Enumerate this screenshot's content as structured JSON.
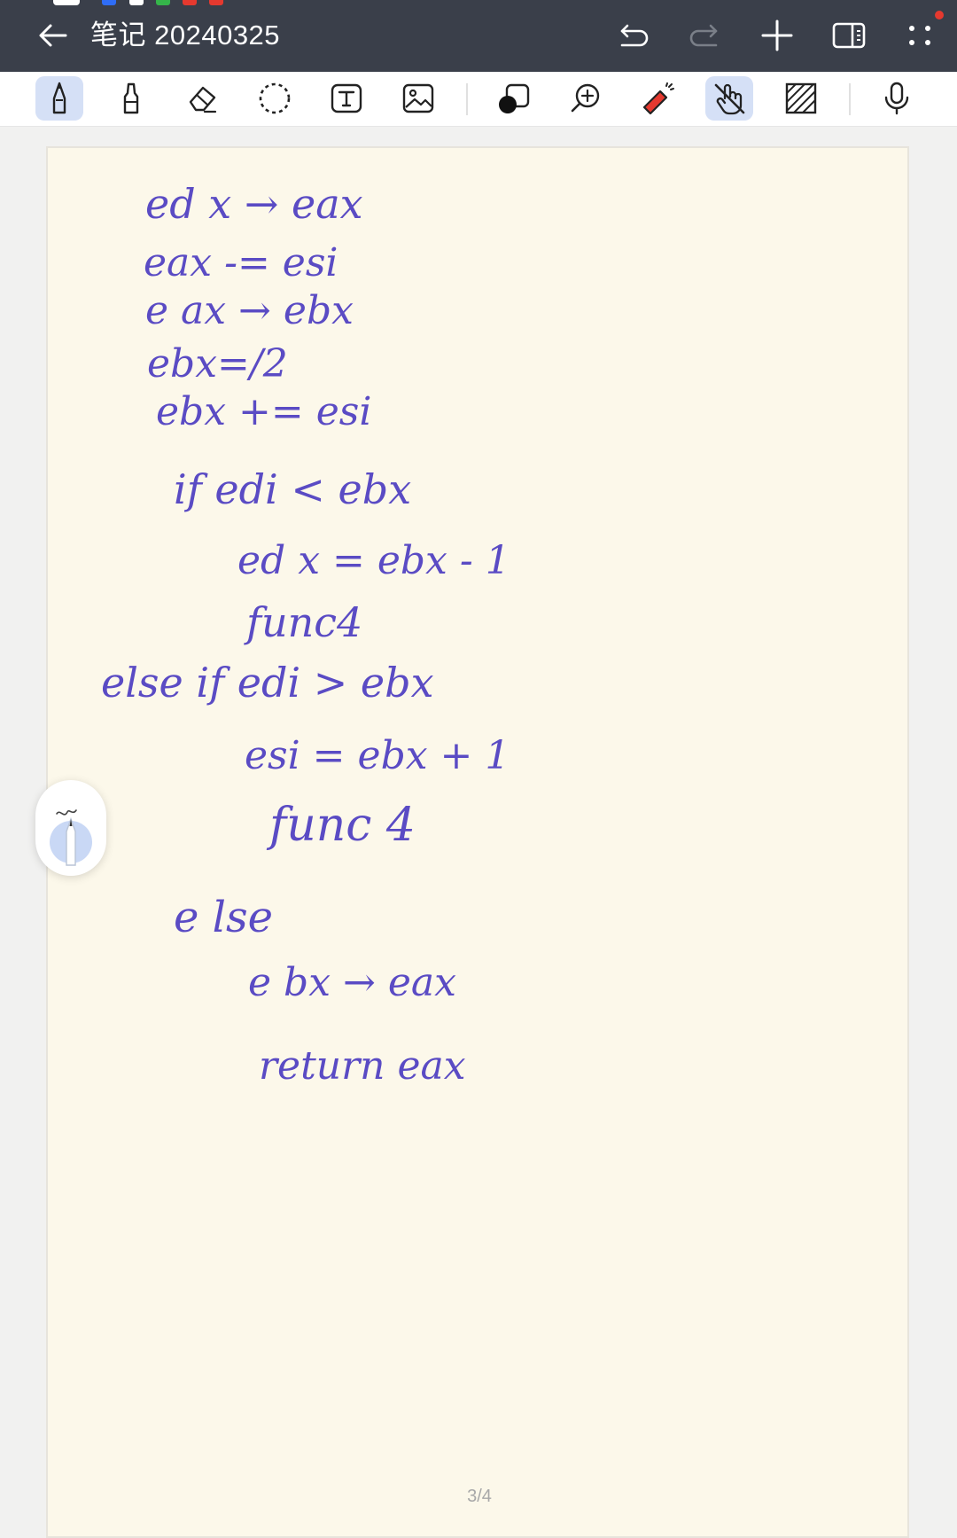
{
  "app": {
    "title": "笔记 20240325"
  },
  "topbar": {
    "back_icon": "arrow-left-icon",
    "actions": [
      {
        "name": "undo",
        "icon": "undo-icon",
        "enabled": true
      },
      {
        "name": "redo",
        "icon": "redo-icon",
        "enabled": false
      },
      {
        "name": "add-page",
        "icon": "plus-icon",
        "enabled": true
      },
      {
        "name": "split-view",
        "icon": "split-panel-icon",
        "enabled": true
      },
      {
        "name": "more",
        "icon": "more-dots-icon",
        "enabled": true
      }
    ],
    "notification_color": "#e5392f",
    "status_dot_colors": [
      "#ffffff",
      "#2f6df6",
      "#ffffff",
      "#35b54a",
      "#e5392f",
      "#e5392f"
    ]
  },
  "toolbar": {
    "tools": [
      {
        "name": "pen",
        "icon": "pen-icon",
        "active": true
      },
      {
        "name": "highlighter",
        "icon": "highlighter-icon",
        "active": false
      },
      {
        "name": "eraser",
        "icon": "eraser-icon",
        "active": false
      },
      {
        "name": "lasso",
        "icon": "lasso-icon",
        "active": false
      },
      {
        "name": "text",
        "icon": "text-box-icon",
        "active": false
      },
      {
        "name": "image",
        "icon": "image-icon",
        "active": false
      },
      {
        "name": "shape",
        "icon": "shape-icon",
        "active": false
      },
      {
        "name": "zoom",
        "icon": "zoom-in-icon",
        "active": false
      },
      {
        "name": "laser-pointer",
        "icon": "laser-pointer-icon",
        "active": false
      },
      {
        "name": "touch-draw",
        "icon": "hand-touch-off-icon",
        "active": true
      },
      {
        "name": "background",
        "icon": "hatch-pattern-icon",
        "active": false
      },
      {
        "name": "voice",
        "icon": "microphone-icon",
        "active": false
      }
    ],
    "active_color": "#d5e0f6"
  },
  "note": {
    "ink_color": "#5a4bc4",
    "lines": [
      "ed x → eax",
      "eax -= esi",
      "e ax → ebx",
      "ebx=/2",
      "ebx += esi",
      "if  edi  <  ebx",
      "ed x = ebx - 1",
      "func4",
      "else if edi  >  ebx",
      "esi = ebx + 1",
      "func 4",
      "e lse",
      "e bx → eax",
      "return  eax"
    ],
    "page_indicator": "3/4"
  },
  "floating_pen": {
    "icon": "pen-quick-icon"
  }
}
